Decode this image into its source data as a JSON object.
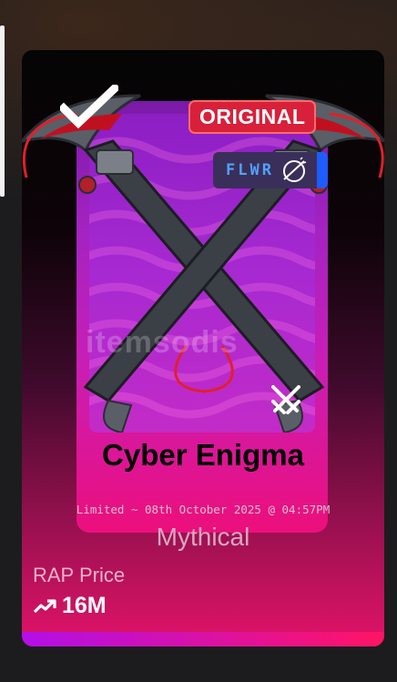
{
  "item": {
    "badge_original": "ORIGINAL",
    "badge_tag": "FLWR",
    "watermark": "itemsodis",
    "name": "Cyber Enigma",
    "limited_line": "Limited ~ 08th October 2025 @ 04:57PM",
    "rarity": "Mythical",
    "rap_label": "RAP Price",
    "rap_value": "16M"
  },
  "icons": {
    "check": "check-icon",
    "flwr": "flwr-icon",
    "swords": "crossed-swords-icon",
    "trend": "trending-up-icon"
  },
  "colors": {
    "original_badge": "#d8203a",
    "flwr_badge_accent": "#1e5cff",
    "card_gradient_end": "#e3136a",
    "bottom_bar_start": "#b20fe8",
    "bottom_bar_end": "#ff1464"
  }
}
